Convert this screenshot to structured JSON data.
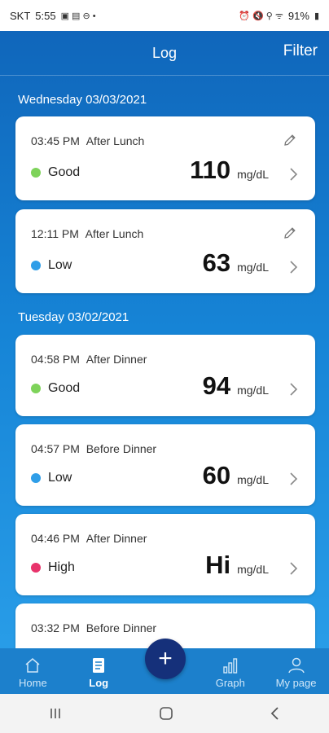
{
  "status_bar": {
    "carrier": "SKT",
    "time": "5:55",
    "battery": "91%"
  },
  "header": {
    "title": "Log",
    "filter_label": "Filter"
  },
  "unit": "mg/dL",
  "groups": [
    {
      "date": "Wednesday 03/03/2021",
      "entries": [
        {
          "time": "03:45 PM",
          "meal": "After Lunch",
          "status": "Good",
          "status_color": "#7ed35a",
          "value": "110",
          "editable": true
        },
        {
          "time": "12:11 PM",
          "meal": "After Lunch",
          "status": "Low",
          "status_color": "#2f9ee8",
          "value": "63",
          "editable": true
        }
      ]
    },
    {
      "date": "Tuesday 03/02/2021",
      "entries": [
        {
          "time": "04:58 PM",
          "meal": "After Dinner",
          "status": "Good",
          "status_color": "#7ed35a",
          "value": "94"
        },
        {
          "time": "04:57 PM",
          "meal": "Before Dinner",
          "status": "Low",
          "status_color": "#2f9ee8",
          "value": "60"
        },
        {
          "time": "04:46 PM",
          "meal": "After Dinner",
          "status": "High",
          "status_color": "#e8336b",
          "value": "Hi"
        },
        {
          "time": "03:32 PM",
          "meal": "Before Dinner"
        }
      ]
    }
  ],
  "bottom_nav": [
    {
      "label": "Home",
      "icon": "home-icon"
    },
    {
      "label": "Log",
      "icon": "log-icon",
      "active": true
    },
    {
      "label": "",
      "icon": "add-icon"
    },
    {
      "label": "Graph",
      "icon": "graph-icon"
    },
    {
      "label": "My page",
      "icon": "person-icon"
    }
  ],
  "fab_symbol": "+"
}
